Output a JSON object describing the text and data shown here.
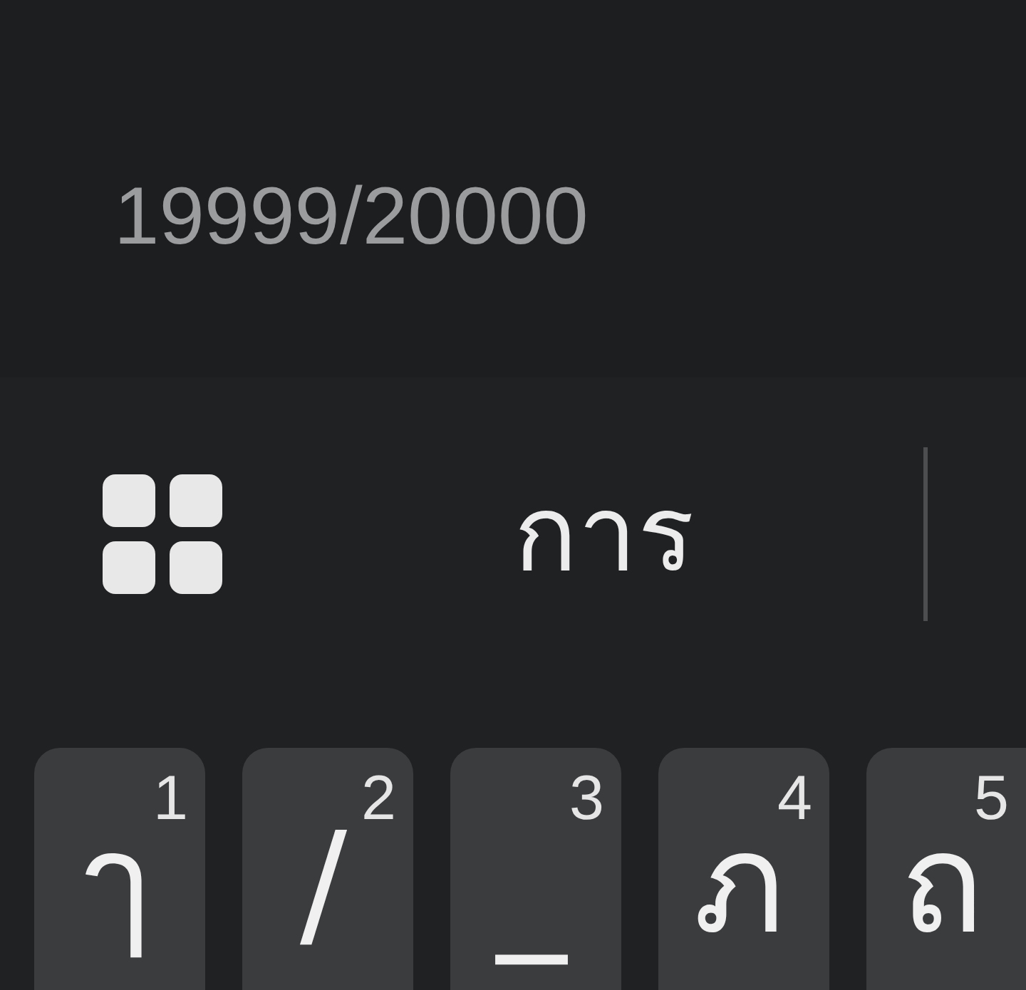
{
  "editor": {
    "counter": "19999/20000"
  },
  "suggestion_bar": {
    "suggestions": [
      "การ"
    ]
  },
  "keyboard": {
    "keys": [
      {
        "label": "ๅ",
        "hint": "1"
      },
      {
        "label": "/",
        "hint": "2"
      },
      {
        "label": "_",
        "hint": "3"
      },
      {
        "label": "ภ",
        "hint": "4"
      },
      {
        "label": "ถ",
        "hint": "5"
      }
    ]
  }
}
